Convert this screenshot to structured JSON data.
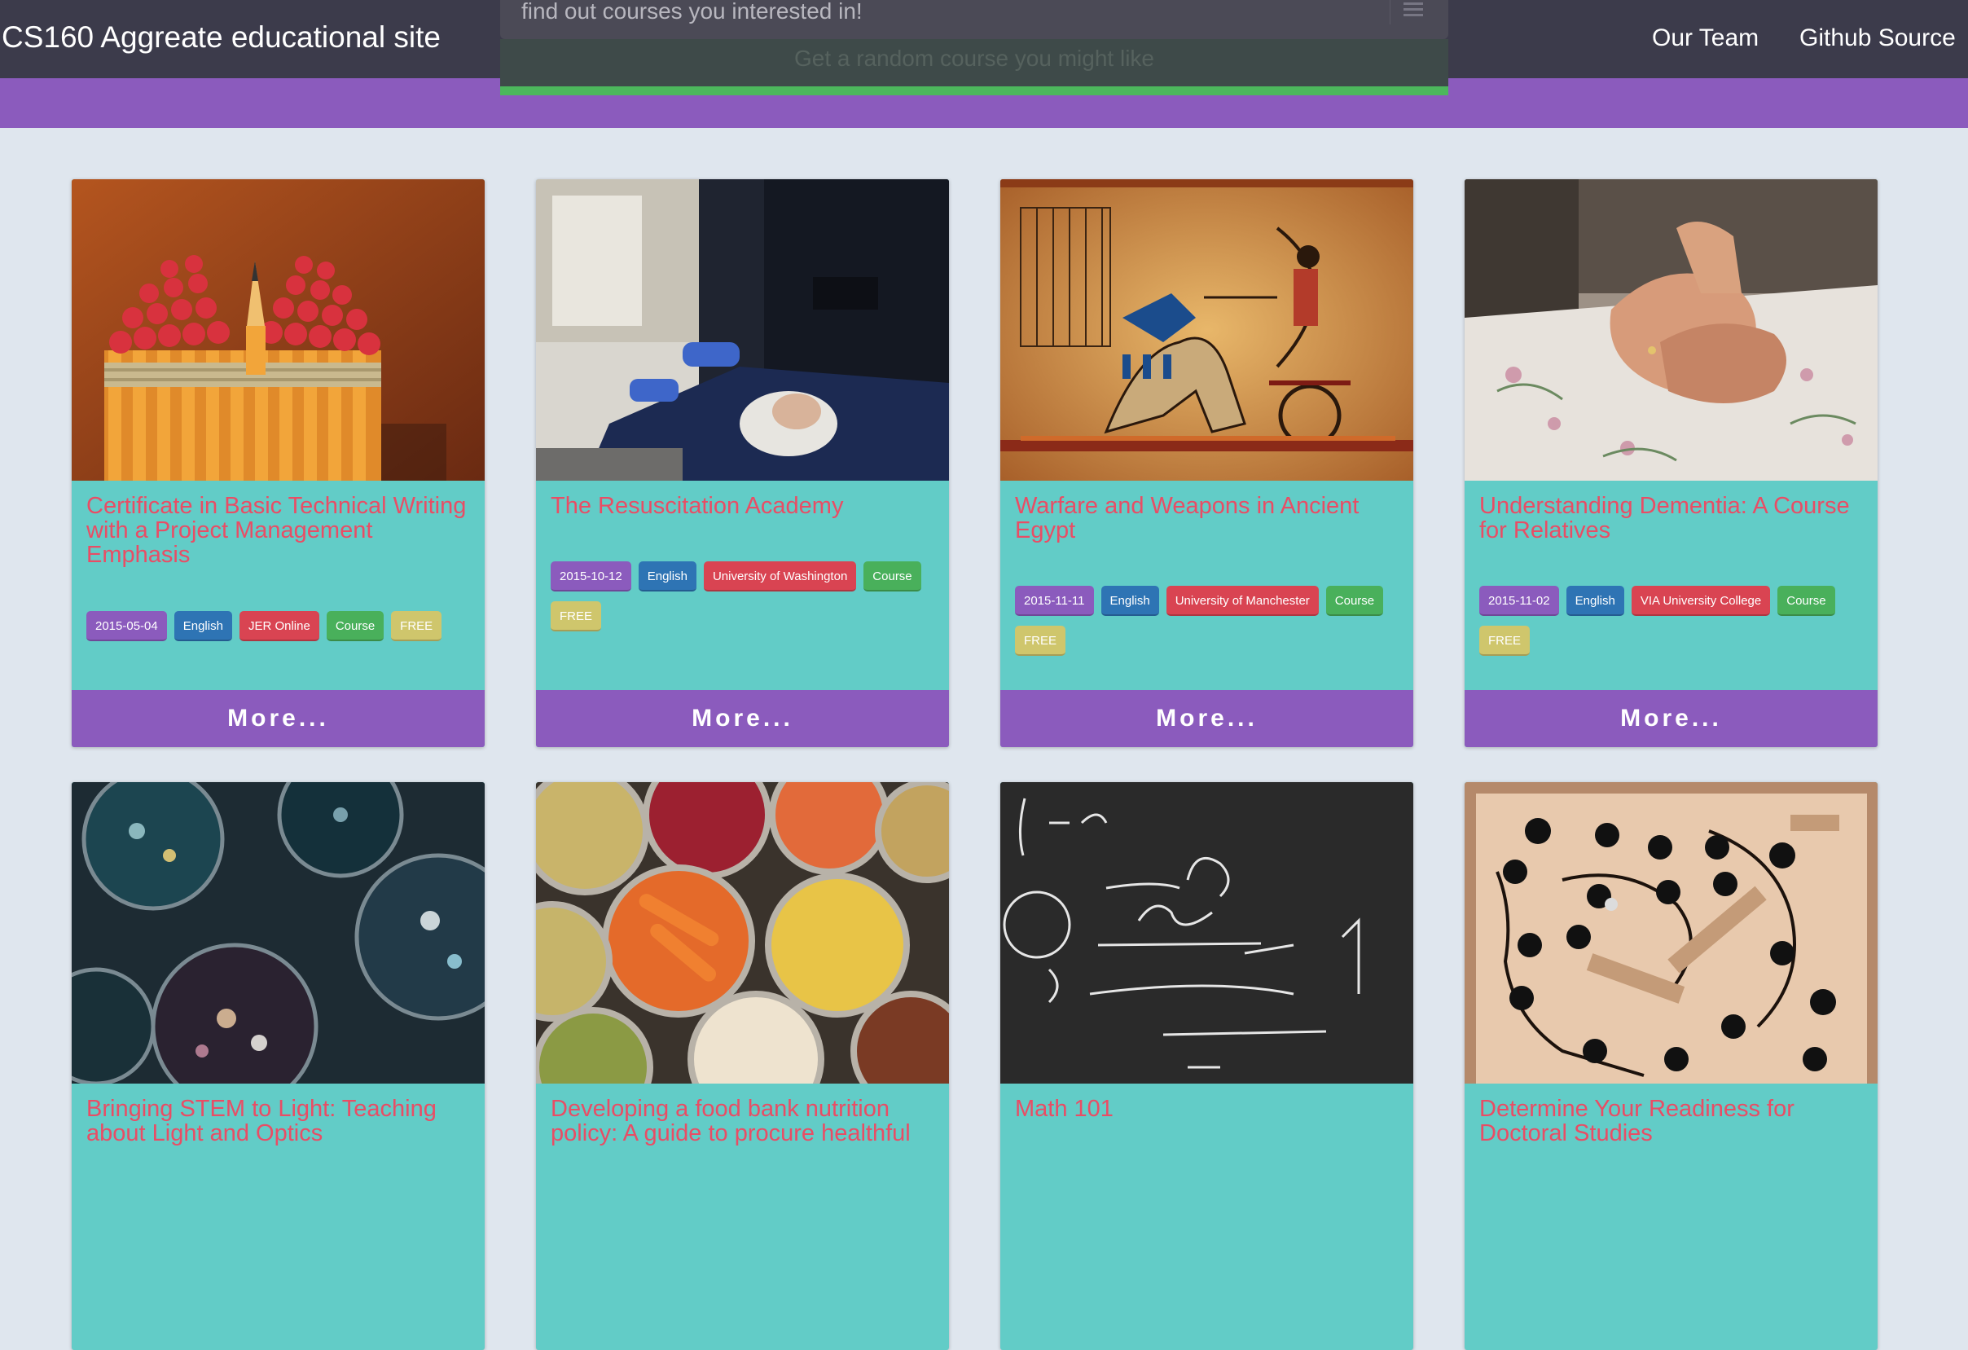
{
  "app": {
    "brand": "CS160 Aggreate educational site",
    "nav": {
      "team": "Our Team",
      "github": "Github Source"
    }
  },
  "search": {
    "placeholder": "find out courses you interested in!",
    "random_label": "Get a random course you might like"
  },
  "colors": {
    "accent_purple": "#8b5bbd",
    "card_teal": "#62ccc7",
    "title_red": "#e94d65",
    "navbar": "#3c3b4b"
  },
  "cards": [
    {
      "title": "Certificate in Basic Technical Writing with a Project Management Emphasis",
      "image": "pencils",
      "tags": {
        "date": "2015-05-04",
        "language": "English",
        "provider": "JER Online",
        "type": "Course",
        "price": "FREE"
      },
      "more": "More..."
    },
    {
      "title": "The Resuscitation Academy",
      "image": "cpr-training",
      "tags": {
        "date": "2015-10-12",
        "language": "English",
        "provider": "University of Washington",
        "type": "Course",
        "price": "FREE"
      },
      "more": "More..."
    },
    {
      "title": "Warfare and Weapons in Ancient Egypt",
      "image": "egyptian-papyrus",
      "tags": {
        "date": "2015-11-11",
        "language": "English",
        "provider": "University of Manchester",
        "type": "Course",
        "price": "FREE"
      },
      "more": "More..."
    },
    {
      "title": "Understanding Dementia: A Course for Relatives",
      "image": "holding-hands",
      "tags": {
        "date": "2015-11-02",
        "language": "English",
        "provider": "VIA University College",
        "type": "Course",
        "price": "FREE"
      },
      "more": "More..."
    },
    {
      "title": "Bringing STEM to Light: Teaching about Light and Optics",
      "image": "lenses"
    },
    {
      "title": "Developing a food bank nutrition policy: A guide to procure healthful",
      "image": "canned-food"
    },
    {
      "title": "Math 101",
      "image": "chalkboard-math"
    },
    {
      "title": "Determine Your Readiness for Doctoral Studies",
      "image": "wooden-maze"
    }
  ]
}
